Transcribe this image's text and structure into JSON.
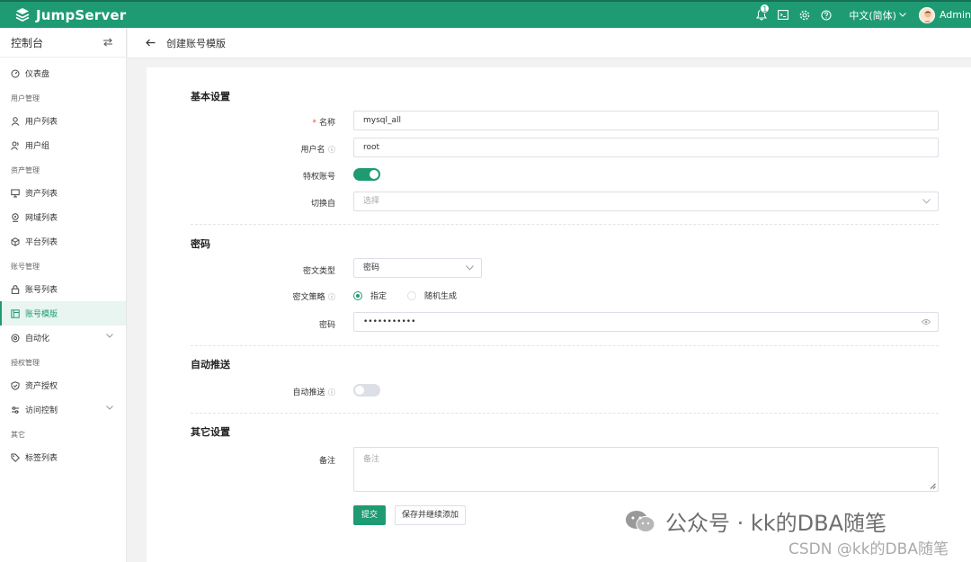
{
  "app": {
    "name": "JumpServer"
  },
  "topbar": {
    "notification_count": "1",
    "language": "中文(简体)",
    "user": "Admin"
  },
  "sidebar": {
    "title": "控制台",
    "groups": [
      {
        "title": "",
        "items": [
          {
            "label": "仪表盘"
          }
        ]
      },
      {
        "title": "用户管理",
        "items": [
          {
            "label": "用户列表"
          },
          {
            "label": "用户组"
          }
        ]
      },
      {
        "title": "资产管理",
        "items": [
          {
            "label": "资产列表"
          },
          {
            "label": "网域列表"
          },
          {
            "label": "平台列表"
          }
        ]
      },
      {
        "title": "账号管理",
        "items": [
          {
            "label": "账号列表"
          },
          {
            "label": "账号模版"
          },
          {
            "label": "自动化"
          }
        ]
      },
      {
        "title": "授权管理",
        "items": [
          {
            "label": "资产授权"
          },
          {
            "label": "访问控制"
          }
        ]
      },
      {
        "title": "其它",
        "items": [
          {
            "label": "标签列表"
          }
        ]
      }
    ]
  },
  "breadcrumb": {
    "title": "创建账号模版"
  },
  "form": {
    "basic": {
      "title": "基本设置",
      "name_label": "名称",
      "name_value": "mysql_all",
      "username_label": "用户名",
      "username_value": "root",
      "privileged_label": "特权账号",
      "su_label": "切换自",
      "su_placeholder": "选择"
    },
    "secret": {
      "title": "密码",
      "type_label": "密文类型",
      "type_value": "密码",
      "strategy_label": "密文策略",
      "strategy_option_specify": "指定",
      "strategy_option_random": "随机生成",
      "password_label": "密码",
      "password_value": "•••••••••••"
    },
    "push": {
      "title": "自动推送",
      "auto_push_label": "自动推送"
    },
    "other": {
      "title": "其它设置",
      "comment_label": "备注",
      "comment_placeholder": "备注"
    },
    "buttons": {
      "submit": "提交",
      "save_continue": "保存并继续添加"
    }
  },
  "watermark": {
    "line1": "公众号 · kk的DBA随笔",
    "line2": "CSDN @kk的DBA随笔"
  },
  "colors": {
    "brand": "#1e9b73"
  }
}
